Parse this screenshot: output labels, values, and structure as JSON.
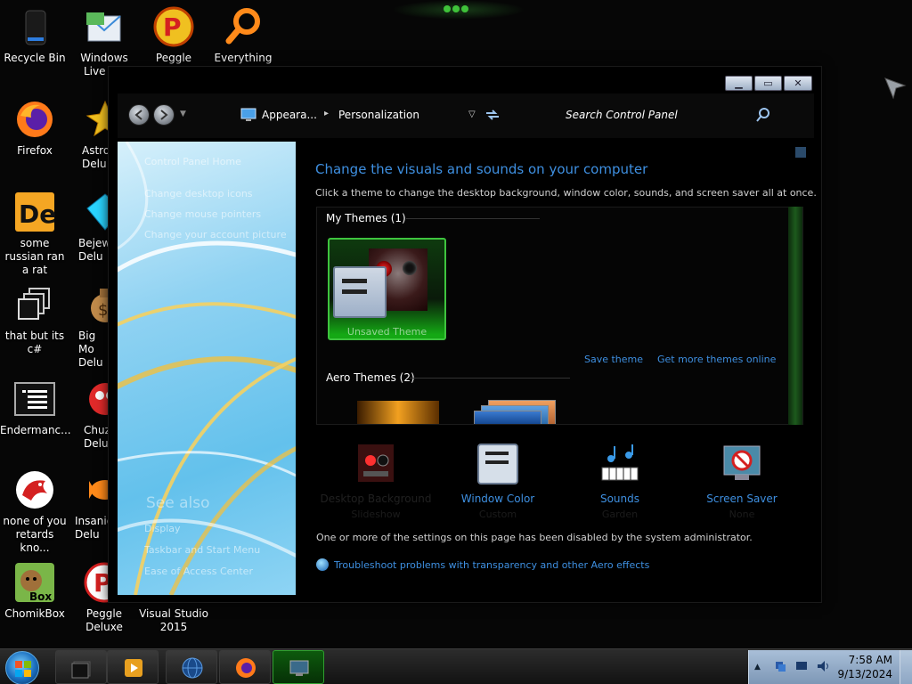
{
  "desktop": {
    "icons_col1": [
      {
        "label": "Recycle Bin",
        "icon": "recycle-bin-icon"
      },
      {
        "label": "Firefox",
        "icon": "firefox-icon"
      },
      {
        "label": "some russian ran a rat",
        "icon": "de-app-icon"
      },
      {
        "label": "that but its c#",
        "icon": "copy-windows-icon"
      },
      {
        "label": "Endermanc...",
        "icon": "terminal-icon"
      },
      {
        "label": "none of you retards kno...",
        "icon": "red-creature-icon"
      },
      {
        "label": "ChomikBox",
        "icon": "chomikbox-icon"
      }
    ],
    "icons_row1": [
      {
        "label": "Windows Live Ma",
        "icon": "windows-live-mail-icon"
      },
      {
        "label": "Peggle World",
        "icon": "peggle-icon"
      },
      {
        "label": "Everything",
        "icon": "magnifier-icon"
      }
    ],
    "icons_col2_partial": [
      {
        "label": "Astro Delu",
        "icon": "astro-icon"
      },
      {
        "label": "Bejew Delu",
        "icon": "diamond-icon"
      },
      {
        "label": "Big Mo Delu",
        "icon": "money-bag-icon"
      },
      {
        "label": "Chuz Delu",
        "icon": "chuzzle-icon"
      },
      {
        "label": "Insaniq Delu",
        "icon": "fish-icon"
      },
      {
        "label": "Peggle Deluxe",
        "icon": "peggle-deluxe-icon"
      }
    ],
    "visual_studio_label_line1": "Visual Studio",
    "visual_studio_label_line2": "2015"
  },
  "window": {
    "breadcrumb": [
      "Appeara...",
      "Personalization"
    ],
    "search_placeholder": "Search Control Panel",
    "left_pane": {
      "home": "Control Panel Home",
      "links": [
        "Change desktop icons",
        "Change mouse pointers",
        "Change your account picture"
      ],
      "see_also": "See also",
      "see_also_links": [
        "Display",
        "Taskbar and Start Menu",
        "Ease of Access Center"
      ]
    },
    "heading": "Change the visuals and sounds on your computer",
    "subtext": "Click a theme to change the desktop background, window color, sounds, and screen saver all at once.",
    "my_themes_title": "My Themes (1)",
    "unsaved_theme_label": "Unsaved Theme",
    "save_theme": "Save theme",
    "get_more_themes": "Get more themes online",
    "aero_themes_title": "Aero Themes (2)",
    "bottom_items": [
      {
        "label": "Desktop Background",
        "sub": "Slideshow",
        "disabled": true,
        "icon": "desktop-background-icon"
      },
      {
        "label": "Window Color",
        "sub": "Custom",
        "disabled": false,
        "icon": "window-color-icon"
      },
      {
        "label": "Sounds",
        "sub": "Garden",
        "disabled": false,
        "icon": "sounds-icon"
      },
      {
        "label": "Screen Saver",
        "sub": "None",
        "disabled": false,
        "icon": "screen-saver-icon"
      }
    ],
    "admin_note": "One or more of the settings on this page has been disabled by the system administrator.",
    "troubleshoot_link": "Troubleshoot problems with transparency and other Aero effects"
  },
  "taskbar": {
    "time": "7:58 AM",
    "date": "9/13/2024"
  },
  "colors": {
    "link_blue": "#3e8fe0",
    "accent_green": "#3ec43e"
  }
}
